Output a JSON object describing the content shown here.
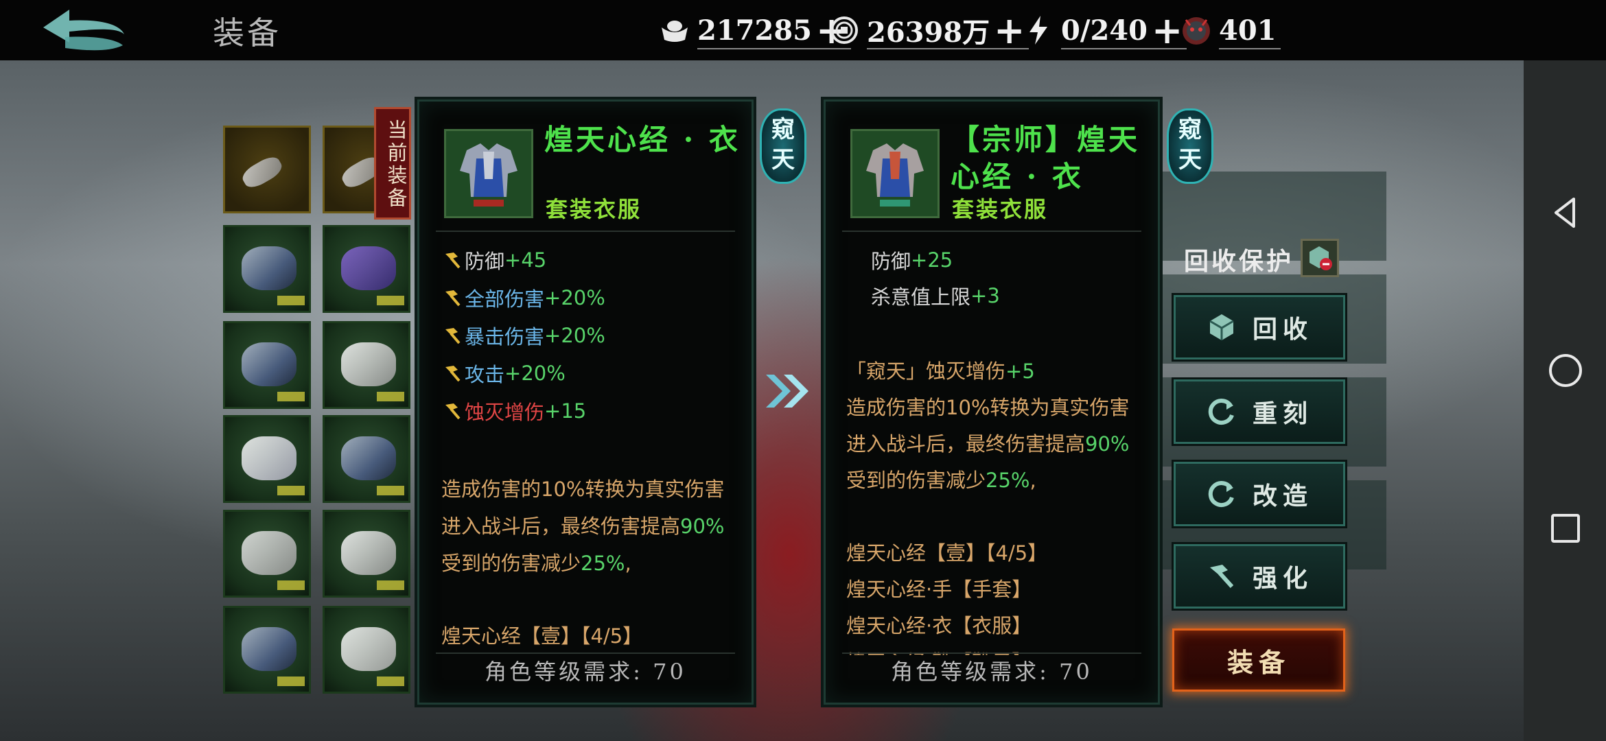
{
  "header": {
    "title": "装备",
    "resources": [
      {
        "icon": "ingot-icon",
        "value": "217285"
      },
      {
        "icon": "coin-icon",
        "value": "26398万"
      },
      {
        "icon": "lightning-icon",
        "value": "0/240"
      },
      {
        "icon": "demon-mask-icon",
        "value": "401"
      }
    ]
  },
  "current_badge": "当前装备",
  "current_item": {
    "name": "煌天心经 · 衣",
    "type": "套装衣服",
    "tier_badge": "窥天",
    "stats": [
      {
        "label": "防御",
        "value": "+45"
      },
      {
        "label": "全部伤害",
        "value": "+20%"
      },
      {
        "label": "暴击伤害",
        "value": "+20%"
      },
      {
        "label": "攻击",
        "value": "+20%"
      },
      {
        "label": "蚀灭增伤",
        "value": "+15"
      }
    ],
    "effects": [
      {
        "pre": "造成伤害的10%转换为真实伤害",
        "hl": "",
        "post": ""
      },
      {
        "pre": "进入战斗后，最终伤害提高",
        "hl": "90%",
        "post": ""
      },
      {
        "pre": "受到的伤害减少",
        "hl": "25%",
        "post": ","
      }
    ],
    "set_title": "煌天心经【壹】【4/5】",
    "requirement": "角色等级需求: 70"
  },
  "compare_item": {
    "name_line1": "【宗师】煌天",
    "name_line2": "心经 · 衣",
    "type": "套装衣服",
    "tier_badge": "窥天",
    "stats": [
      {
        "label": "防御",
        "value": "+25"
      },
      {
        "label": "杀意值上限",
        "value": "+3"
      }
    ],
    "special": {
      "label": "「窥天」蚀灭增伤",
      "value": "+5"
    },
    "effects": [
      {
        "pre": "造成伤害的10%转换为真实伤害",
        "hl": "",
        "post": ""
      },
      {
        "pre": "进入战斗后，最终伤害提高",
        "hl": "90%",
        "post": ""
      },
      {
        "pre": "受到的伤害减少",
        "hl": "25%",
        "post": ","
      }
    ],
    "set_title": "煌天心经【壹】【4/5】",
    "set_pieces": [
      "煌天心经·手【手套】",
      "煌天心经·衣【衣服】",
      "煌天心经·靴【靴子】"
    ],
    "requirement": "角色等级需求: 70"
  },
  "actions": {
    "recycle_protect_label": "回收保护",
    "recycle": "回收",
    "reforge": "重刻",
    "modify": "改造",
    "enhance": "强化",
    "equip": "装备"
  },
  "colors": {
    "item_name": "#4ee24c",
    "stat_value": "#58d46a",
    "stat_blue": "#6bb6e8",
    "stat_red": "#e04545",
    "effect_text": "#d8a66a",
    "equip_glow": "#e3621a"
  }
}
